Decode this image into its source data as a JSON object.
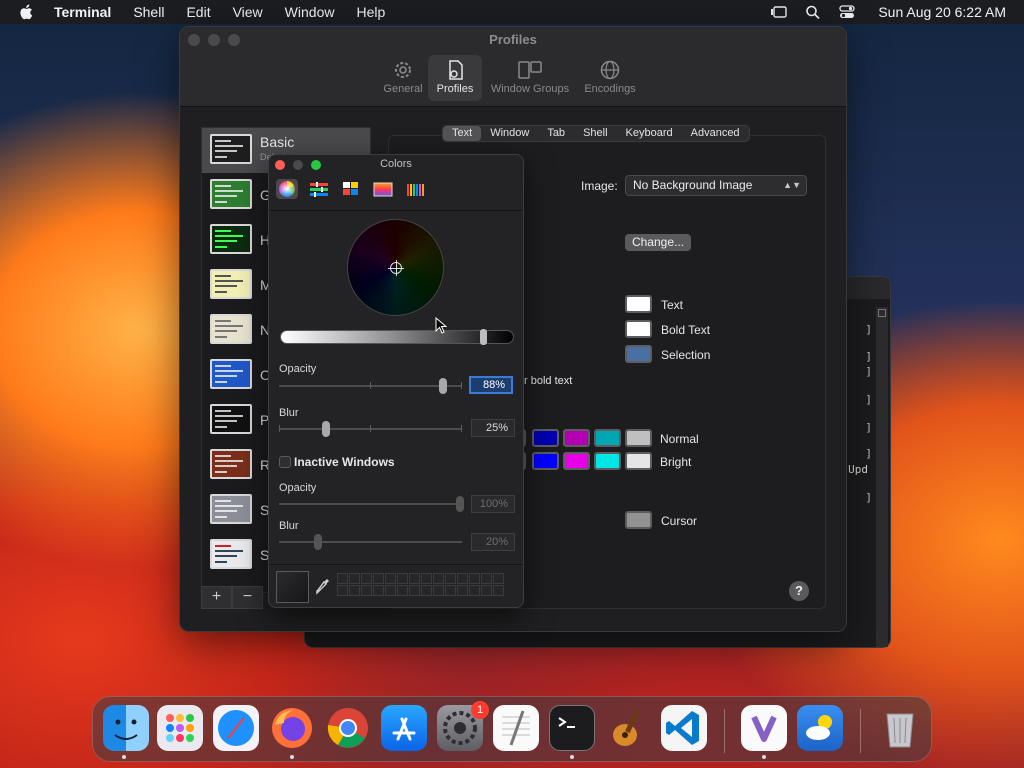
{
  "menubar": {
    "app": "Terminal",
    "items": [
      "Shell",
      "Edit",
      "View",
      "Window",
      "Help"
    ],
    "clock": "Sun Aug 20  6:22 AM"
  },
  "settings": {
    "title": "Profiles",
    "toolbar": [
      "General",
      "Profiles",
      "Window Groups",
      "Encodings"
    ],
    "profiles": [
      {
        "name": "Basic",
        "sub": "Default"
      },
      {
        "name": "G"
      },
      {
        "name": "H"
      },
      {
        "name": "M"
      },
      {
        "name": "N"
      },
      {
        "name": "O"
      },
      {
        "name": "Pr"
      },
      {
        "name": "Re"
      },
      {
        "name": "Si"
      },
      {
        "name": "Sp"
      }
    ],
    "add_label": "+",
    "remove_label": "−",
    "tabs": [
      "Text",
      "Window",
      "Tab",
      "Shell",
      "Keyboard",
      "Advanced"
    ],
    "image_label": "Image:",
    "image_value": "No Background Image",
    "change_button": "Change...",
    "text_color_label": "Text",
    "bold_text_label": "Bold Text",
    "selection_label": "Selection",
    "bold_hint": "r bold text",
    "normal_label": "Normal",
    "bright_label": "Bright",
    "cursor_label": "Cursor",
    "help": "?"
  },
  "colors": {
    "title": "Colors",
    "opacity_label": "Opacity",
    "opacity_value": "88%",
    "blur_label": "Blur",
    "blur_value": "25%",
    "inactive_label": "Inactive Windows",
    "inactive_opacity_label": "Opacity",
    "inactive_opacity_value": "100%",
    "inactive_blur_label": "Blur",
    "inactive_blur_value": "20%"
  },
  "bg_terminal": {
    "upd_text": "Upd"
  },
  "palette": {
    "text": "#ffffff",
    "bold_text": "#ffffff",
    "selection": "#4a6fa5",
    "cursor": "#929292",
    "normal": [
      "#0000b2",
      "#b200b2",
      "#00a6b2",
      "#bfbfbf"
    ],
    "bright": [
      "#0000ff",
      "#e500e5",
      "#00e5e5",
      "#e5e5e5"
    ]
  },
  "dock": {
    "apps": [
      "finder-icon",
      "launchpad-icon",
      "safari-icon",
      "firefox-icon",
      "chrome-icon",
      "app-store-icon",
      "system-settings-icon",
      "textedit-icon",
      "terminal-icon",
      "garageband-icon",
      "vscode-icon",
      "visual-studio-icon",
      "weather-icon",
      "trash-icon"
    ],
    "settings_badge": "1"
  }
}
